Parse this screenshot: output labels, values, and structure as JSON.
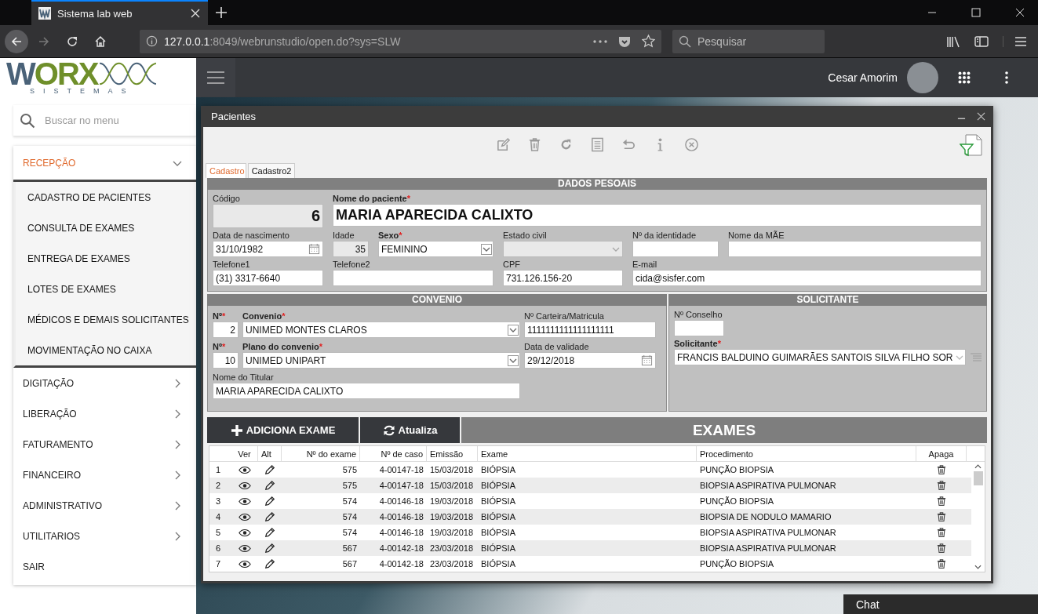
{
  "browser": {
    "tab_title": "Sistema lab web",
    "url_host": "127.0.0.1",
    "url_rest": ":8049/webrunstudio/open.do?sys=SLW",
    "search_placeholder": "Pesquisar"
  },
  "header": {
    "logo_word": "WORX",
    "logo_sub": "SISTEMAS",
    "user_name": "Cesar Amorim"
  },
  "sidebar": {
    "search_placeholder": "Buscar no menu",
    "items": [
      {
        "label": "RECEPÇÃO",
        "kind": "group",
        "expanded": true,
        "children": [
          {
            "label": "CADASTRO DE PACIENTES"
          },
          {
            "label": "CONSULTA DE EXAMES"
          },
          {
            "label": "ENTREGA DE EXAMES"
          },
          {
            "label": "LOTES DE EXAMES"
          },
          {
            "label": "MÉDICOS E DEMAIS SOLICITANTES"
          },
          {
            "label": "MOVIMENTAÇÃO NO CAIXA"
          }
        ]
      },
      {
        "label": "DIGITAÇÃO",
        "kind": "group",
        "expanded": false
      },
      {
        "label": "LIBERAÇÃO",
        "kind": "group",
        "expanded": false
      },
      {
        "label": "FATURAMENTO",
        "kind": "group",
        "expanded": false
      },
      {
        "label": "FINANCEIRO",
        "kind": "group",
        "expanded": false
      },
      {
        "label": "ADMINISTRATIVO",
        "kind": "group",
        "expanded": false
      },
      {
        "label": "UTILITARIOS",
        "kind": "group",
        "expanded": false
      },
      {
        "label": "SAIR",
        "kind": "link"
      }
    ]
  },
  "window": {
    "title": "Pacientes",
    "tabs": [
      {
        "label": "Cadastro",
        "selected": true
      },
      {
        "label": "Cadastro2",
        "selected": false
      }
    ],
    "personal": {
      "heading": "DADOS PESOAIS",
      "fields": [
        {
          "label": "Código",
          "value": "6",
          "kind": "code",
          "disabled": true
        },
        {
          "label": "Nome do paciente",
          "required_mark": "*",
          "value": "MARIA APARECIDA CALIXTO",
          "kind": "name",
          "disabled": false
        },
        {
          "label": "Data de nascimento",
          "value": "31/10/1982",
          "kind": "date",
          "disabled": false
        },
        {
          "label": "Idade",
          "value": "35",
          "kind": "number",
          "disabled": true
        },
        {
          "label": "Sexo",
          "required_mark": "*",
          "value": "FEMININO",
          "kind": "select",
          "disabled": false
        },
        {
          "label": "Estado civil",
          "kind": "select",
          "disabled": true
        },
        {
          "label": "Nº da identidade",
          "kind": "text",
          "disabled": false
        },
        {
          "label": "Nome da MÃE",
          "kind": "text",
          "disabled": false
        },
        {
          "label": "Telefone1",
          "value": "(31) 3317-6640",
          "kind": "text",
          "disabled": false
        },
        {
          "label": "Telefone2",
          "kind": "text",
          "disabled": false
        },
        {
          "label": "CPF",
          "value": "731.126.156-20",
          "kind": "text",
          "disabled": false
        },
        {
          "label": "E-mail",
          "value": "cida@sisfer.com",
          "kind": "text",
          "disabled": false
        }
      ]
    },
    "convenio": {
      "heading": "CONVENIO",
      "fields": [
        {
          "label": "Nº",
          "required_mark": "*",
          "value": "2",
          "kind": "number",
          "disabled": false
        },
        {
          "label": "Convenio",
          "required_mark": "*",
          "value": "UNIMED MONTES CLAROS",
          "kind": "select",
          "disabled": false
        },
        {
          "label": "Nº Carteira/Matricula",
          "value": "1111111111111111111",
          "kind": "text",
          "disabled": false
        },
        {
          "label": "Nº",
          "required_mark": "*",
          "value": "10",
          "kind": "number",
          "disabled": false
        },
        {
          "label": "Plano do convenio",
          "required_mark": "*",
          "value": "UNIMED UNIPART",
          "kind": "select",
          "disabled": false
        },
        {
          "label": "Data de validade",
          "value": "29/12/2018",
          "kind": "date",
          "disabled": false
        },
        {
          "label": "Nome do Titular",
          "value": "MARIA APARECIDA CALIXTO",
          "kind": "text",
          "disabled": false
        }
      ]
    },
    "solicitante": {
      "heading": "SOLICITANTE",
      "fields": [
        {
          "label": "Nº Conselho",
          "kind": "text",
          "disabled": false
        },
        {
          "label": "Solicitante",
          "required_mark": "*",
          "value": "FRANCIS BALDUINO GUIMARÃES SANTOIS SILVA FILHO SOR",
          "kind": "lookup",
          "disabled": false
        }
      ]
    },
    "exams": {
      "add_button": "ADICIONA EXAME",
      "refresh_button": "Atualiza",
      "title": "EXAMES",
      "columns": [
        "Ver",
        "Alt",
        "Nº do exame",
        "Nº de caso",
        "Emissão",
        "Exame",
        "Procedimento",
        "Apaga"
      ],
      "rows": [
        {
          "index": "1",
          "exam_no": "575",
          "case_no": "4-00147-18",
          "issued": "15/03/2018",
          "exam": "BIÓPSIA",
          "procedure": "PUNÇÃO BIOPSIA"
        },
        {
          "index": "2",
          "exam_no": "575",
          "case_no": "4-00147-18",
          "issued": "15/03/2018",
          "exam": "BIÓPSIA",
          "procedure": "BIOPSIA ASPIRATIVA PULMONAR"
        },
        {
          "index": "3",
          "exam_no": "574",
          "case_no": "4-00146-18",
          "issued": "19/03/2018",
          "exam": "BIÓPSIA",
          "procedure": "PUNÇÃO BIOPSIA"
        },
        {
          "index": "4",
          "exam_no": "574",
          "case_no": "4-00146-18",
          "issued": "19/03/2018",
          "exam": "BIÓPSIA",
          "procedure": "BIOPSIA DE NODULO MAMARIO"
        },
        {
          "index": "5",
          "exam_no": "574",
          "case_no": "4-00146-18",
          "issued": "19/03/2018",
          "exam": "BIÓPSIA",
          "procedure": "BIOPSIA ASPIRATIVA PULMONAR"
        },
        {
          "index": "6",
          "exam_no": "567",
          "case_no": "4-00142-18",
          "issued": "23/03/2018",
          "exam": "BIÓPSIA",
          "procedure": "BIOPSIA ASPIRATIVA PULMONAR"
        },
        {
          "index": "7",
          "exam_no": "567",
          "case_no": "4-00142-18",
          "issued": "23/03/2018",
          "exam": "BIÓPSIA",
          "procedure": "PUNÇÃO BIOPSIA"
        }
      ]
    }
  },
  "chat": {
    "label": "Chat"
  }
}
